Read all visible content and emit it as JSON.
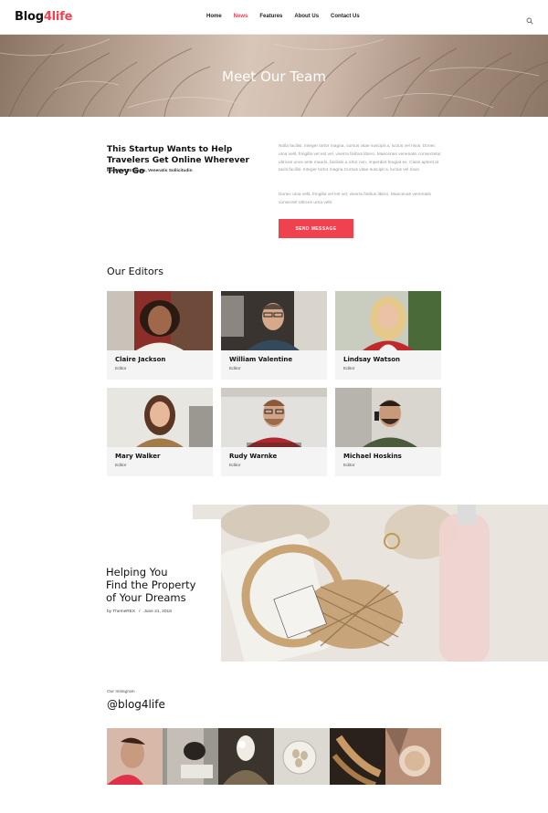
{
  "header": {
    "logo_main": "Blog",
    "logo_accent": "4life",
    "nav": [
      "Home",
      "News",
      "Features",
      "About Us",
      "Contact Us"
    ],
    "active_index": 1,
    "search_icon": "search-icon"
  },
  "hero": {
    "title": "Meet Our Team"
  },
  "intro": {
    "title": "This Startup Wants to Help Travelers Get Online Wherever They Go",
    "subtitle": "Nam Ut Rutrum Ex, Veneratis Sollicitudin",
    "paragraph1": "Nulla facilisi. Integer tortor magna, cursus vitae suscipit a, luctus vel risus. Donec uma velit, fringilla vel est vel, viverra finibus libero. Maecenas venenatis consectetur ultrices unce ante mauris, facilisis a ortor non, imperdiet feugiat ex. Class aptent at taciti facilisi. Integer tortor magna.Cursus vitae suscipit a, luctus vel risus.",
    "paragraph2": "Donec uma velit, fringilla vel est vel, viverra finibus libero. Maecenas venenatis consectet ultrices urna velit.",
    "button": "SEND MESSAGE"
  },
  "editors": {
    "title": "Our Editors",
    "members": [
      {
        "name": "Claire Jackson",
        "role": "Editor"
      },
      {
        "name": "William Valentine",
        "role": "Editor"
      },
      {
        "name": "Lindsay Watson",
        "role": "Editor"
      },
      {
        "name": "Mary Walker",
        "role": "Editor"
      },
      {
        "name": "Rudy Warnke",
        "role": "Editor"
      },
      {
        "name": "Michael Hoskins",
        "role": "Editor"
      }
    ]
  },
  "feature": {
    "title_line1": "Helping You",
    "title_line2": "Find the Property",
    "title_line3": "of Your Dreams",
    "author": "by ThemeREX",
    "separator": "/",
    "date": "June 21, 2018"
  },
  "instagram": {
    "label": "Our Instagram",
    "handle": "@blog4life"
  },
  "colors": {
    "accent": "#f0414f",
    "card_bg": "#f4f4f4"
  }
}
